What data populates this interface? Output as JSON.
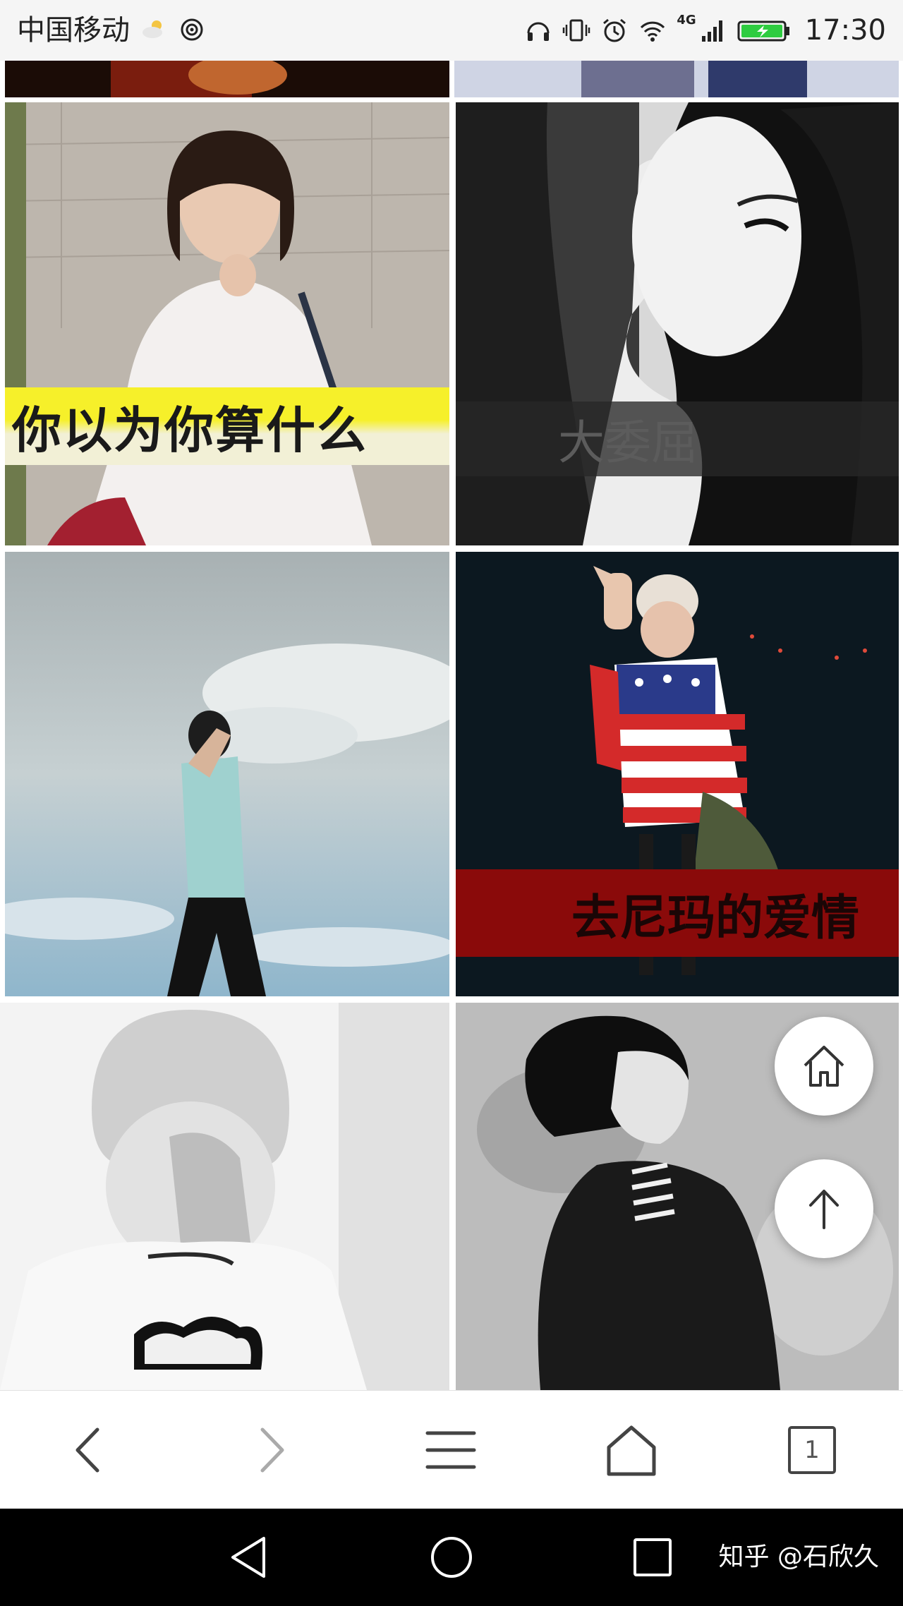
{
  "status_bar": {
    "carrier": "中国移动",
    "network_label": "4G",
    "time": "17:30",
    "icons": [
      "weather-partly-sunny-icon",
      "hotspot-icon",
      "headphones-icon",
      "vibrate-icon",
      "alarm-icon",
      "wifi-icon",
      "signal-icon",
      "battery-charging-icon"
    ]
  },
  "grid": {
    "captions": {
      "tile_1": "你以为你算什么",
      "tile_2": "大委屈",
      "tile_4": "去尼玛的爱情"
    }
  },
  "floating": {
    "home_icon": "home-outline-icon",
    "top_icon": "arrow-up-icon"
  },
  "toolbar": {
    "tab_count": "1",
    "icons": [
      "back-icon",
      "forward-icon",
      "menu-icon",
      "home-icon",
      "tabs-icon"
    ]
  },
  "nav_bar": {
    "watermark": "知乎 @石欣久",
    "icons": [
      "nav-back-icon",
      "nav-home-icon",
      "nav-recents-icon"
    ]
  },
  "colors": {
    "caption_yellow": "#f6f02a",
    "caption_red": "#8a0a0a",
    "battery_green": "#2ecc40"
  }
}
